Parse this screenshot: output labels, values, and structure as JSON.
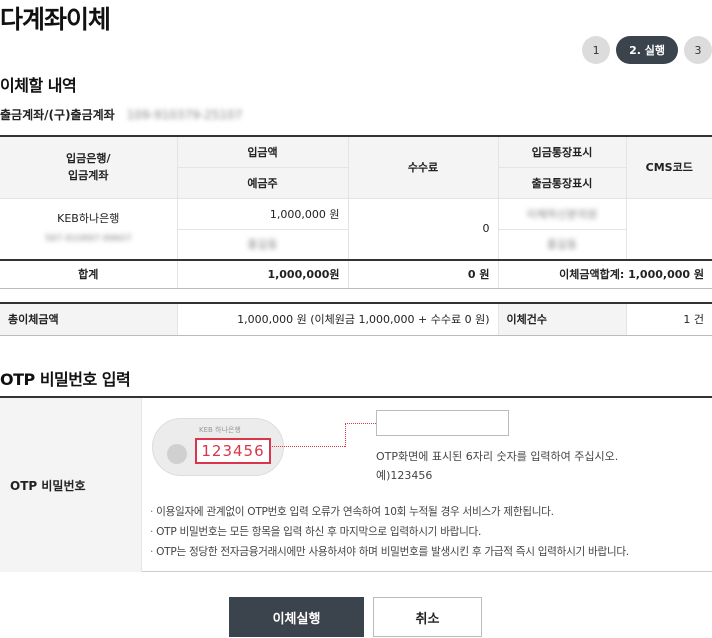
{
  "page": {
    "title": "다계좌이체"
  },
  "steps": [
    {
      "label": "1",
      "active": false
    },
    {
      "label": "2. 실행",
      "active": true
    },
    {
      "label": "3",
      "active": false
    }
  ],
  "transfer": {
    "section_title": "이체할 내역",
    "account_label": "출금계좌/(구)출금계좌",
    "account_number": "109-910379-25107",
    "headers": {
      "bank_account": "입금은행/\n입금계좌",
      "amount": "입금액",
      "depositor": "예금주",
      "fee": "수수료",
      "recipient_display": "입금통장표시",
      "sender_display": "출금통장표시",
      "cms": "CMS코드"
    },
    "row": {
      "bank": "KEB하나은행",
      "account": "587-910897-99607",
      "amount": "1,000,000 원",
      "depositor": "홍길동",
      "fee": "0",
      "recipient_display": "이체하신분의원",
      "sender_display": "홍길동",
      "cms": ""
    },
    "total": {
      "label": "합계",
      "amount": "1,000,000원",
      "fee": "0 원",
      "sum": "이체금액합계: 1,000,000 원"
    },
    "summary": {
      "total_label": "총이체금액",
      "total_value": "1,000,000 원 (이체원금 1,000,000 + 수수료 0 원)",
      "count_label": "이체건수",
      "count_value": "1 건"
    }
  },
  "otp": {
    "section_title": "OTP 비밀번호 입력",
    "label": "OTP 비밀번호",
    "device_brand": "KEB 하나은행",
    "device_code": "123456",
    "input_value": "",
    "help_line1": "OTP화면에 표시된 6자리 숫자를 입력하여 주십시오.",
    "help_line2": "예)123456",
    "notes": [
      "이용일자에 관계없이 OTP번호 입력 오류가 연속하여 10회 누적될 경우 서비스가 제한됩니다.",
      "OTP 비밀번호는 모든 항목을 입력 하신 후 마지막으로 입력하시기 바랍니다.",
      "OTP는 정당한 전자금융거래시에만 사용하셔야 하며 비밀번호를 발생시킨 후 가급적 즉시 입력하시기 바랍니다."
    ]
  },
  "buttons": {
    "execute": "이체실행",
    "cancel": "취소"
  },
  "colors": {
    "primary": "#3b434d",
    "otp_accent": "#d9354b"
  }
}
